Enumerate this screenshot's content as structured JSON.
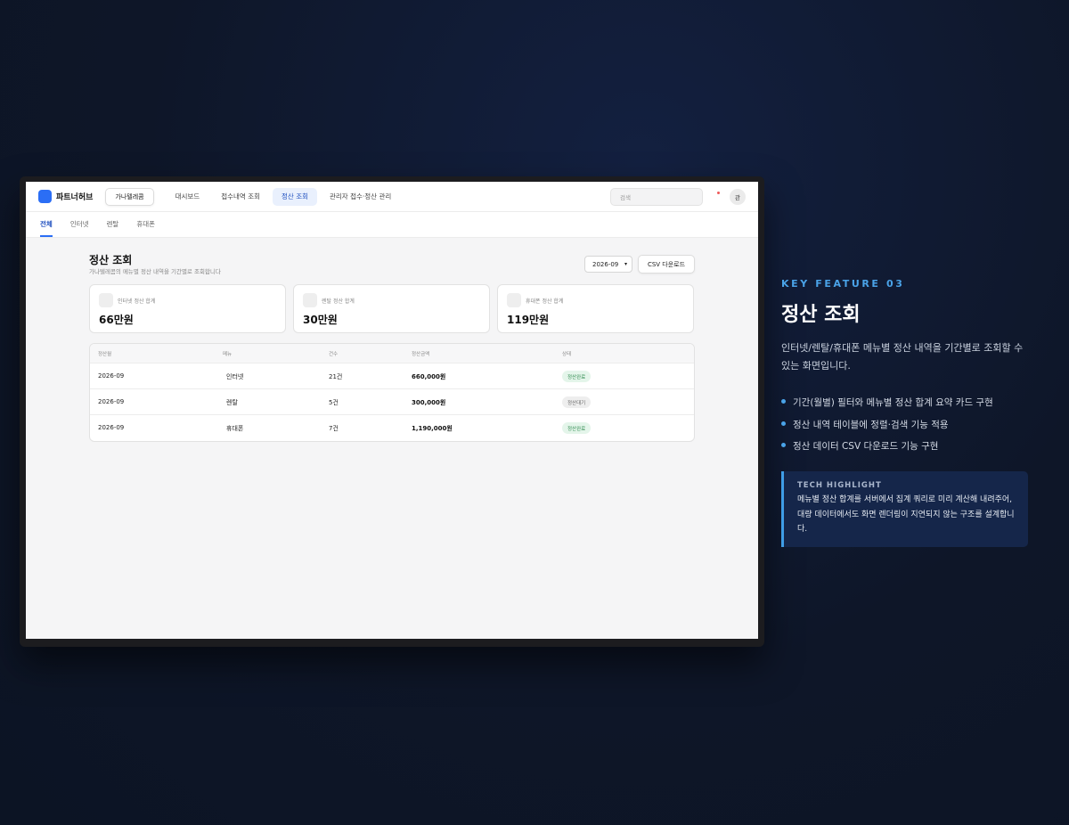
{
  "app": {
    "logo_text": "파트너허브",
    "org_button": "가나텔레콤",
    "nav": [
      {
        "label": "대시보드",
        "active": false
      },
      {
        "label": "접수내역 조회",
        "active": false
      },
      {
        "label": "정산 조회",
        "active": true
      },
      {
        "label": "관리자 접수·정산 관리",
        "active": false
      }
    ],
    "search_placeholder": "검색",
    "avatar_text": "관"
  },
  "subtabs": [
    {
      "label": "전체",
      "active": true
    },
    {
      "label": "인터넷",
      "active": false
    },
    {
      "label": "렌탈",
      "active": false
    },
    {
      "label": "휴대폰",
      "active": false
    }
  ],
  "page": {
    "title": "정산 조회",
    "subtitle": "가나텔레콤의 메뉴별 정산 내역을 기간별로 조회합니다",
    "month_select": "2026-09",
    "csv_button": "CSV 다운로드"
  },
  "summary_cards": [
    {
      "label": "인터넷 정산 합계",
      "value": "66만원"
    },
    {
      "label": "렌탈 정산 합계",
      "value": "30만원"
    },
    {
      "label": "휴대폰 정산 합계",
      "value": "119만원"
    }
  ],
  "table": {
    "headers": [
      "정산월",
      "메뉴",
      "건수",
      "정산금액",
      "상태"
    ],
    "rows": [
      {
        "month": "2026-09",
        "menu": "인터넷",
        "count": "21건",
        "amount": "660,000원",
        "status": "정산완료"
      },
      {
        "month": "2026-09",
        "menu": "렌탈",
        "count": "5건",
        "amount": "300,000원",
        "status": "정산대기"
      },
      {
        "month": "2026-09",
        "menu": "휴대폰",
        "count": "7건",
        "amount": "1,190,000원",
        "status": "정산완료"
      }
    ]
  },
  "feature": {
    "label": "KEY FEATURE 03",
    "title": "정산 조회",
    "description": "인터넷/렌탈/휴대폰 메뉴별 정산 내역을 기간별로 조회할 수 있는 화면입니다.",
    "bullets": [
      "기간(월별) 필터와 메뉴별 정산 합계 요약 카드 구현",
      "정산 내역 테이블에 정렬·검색 기능 적용",
      "정산 데이터 CSV 다운로드 기능 구현"
    ],
    "tech_label": "TECH HIGHLIGHT",
    "tech_text": "메뉴별 정산 합계를 서버에서 집계 쿼리로 미리 계산해 내려주어, 대량 데이터에서도 화면 렌더링이 지연되지 않는 구조를 설계합니다."
  },
  "colors": {
    "accent": "#2b6ef5",
    "background": "#0e1628",
    "feature_accent": "#4aa3e8",
    "badge_done": "#e4f5ea",
    "badge_wait": "#eeeeee"
  }
}
